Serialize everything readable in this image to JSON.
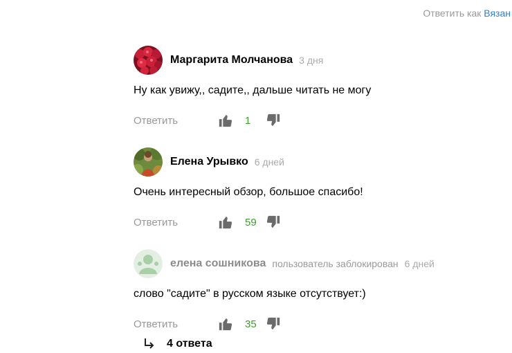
{
  "header": {
    "reply_as_prefix": "Ответить как",
    "reply_as_user": "Вязан"
  },
  "comments": [
    {
      "author": "Маргарита Молчанова",
      "badge": "",
      "date": "3 дня",
      "text": "Ну как увижу,, садите,, дальше читать не могу",
      "reply_label": "Ответить",
      "likes": "1",
      "avatar": "raspberry-photo"
    },
    {
      "author": "Елена Урывко",
      "badge": "",
      "date": "6 дней",
      "text": "Очень интересный обзор, большое спасибо!",
      "reply_label": "Ответить",
      "likes": "59",
      "avatar": "woman-in-garden-photo"
    },
    {
      "author": "елена сошникова",
      "badge": "пользователь заблокирован",
      "date": "6 дней",
      "text": "слово \"садите\" в русском языке отсутствует:)",
      "reply_label": "Ответить",
      "likes": "35",
      "avatar": "default-user-icon"
    }
  ],
  "thread": {
    "answers_label": "4 ответа"
  },
  "colors": {
    "link": "#2f80c6",
    "likes": "#3c9c2a",
    "muted": "#999999",
    "icon": "#6b6b6b"
  }
}
